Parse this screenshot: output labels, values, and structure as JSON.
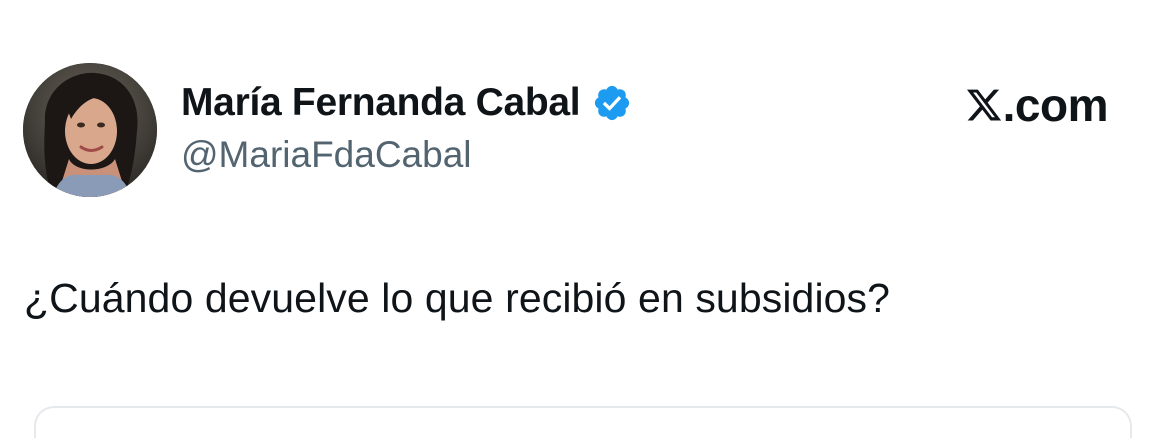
{
  "author": {
    "display_name": "María Fernanda Cabal",
    "handle": "@MariaFdaCabal",
    "verified": true,
    "avatar_icon": "profile-photo"
  },
  "brand": {
    "label": ".com",
    "icon": "x-logo-icon"
  },
  "tweet": {
    "text": "¿Cuándo devuelve lo que recibió en subsidios?"
  },
  "colors": {
    "text_primary": "#0f1419",
    "text_secondary": "#536471",
    "verified_blue": "#1d9bf0",
    "border": "#e6e9ec"
  }
}
